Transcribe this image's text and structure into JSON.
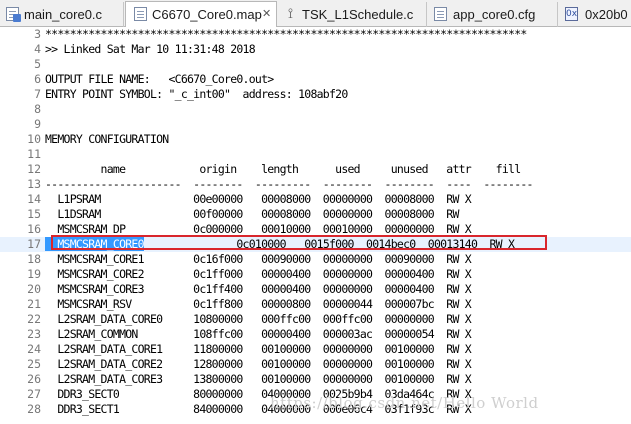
{
  "tabs": [
    {
      "label": "main_core0.c",
      "icon": "c-file-icon",
      "active": false,
      "close": ""
    },
    {
      "label": "C6670_Core0.map",
      "icon": "text-file-icon",
      "active": true,
      "close": "✕"
    },
    {
      "label": "TSK_L1Schedule.c",
      "icon": "tsk-file-icon",
      "active": false,
      "close": ""
    },
    {
      "label": "app_core0.cfg",
      "icon": "cfg-file-icon",
      "active": false,
      "close": ""
    },
    {
      "label": "0x20b0",
      "icon": "memory-icon",
      "active": false,
      "close": ""
    }
  ],
  "hex_icon_glyph": "0x",
  "tsk_icon_glyph": "⟟",
  "editor": {
    "lines": [
      {
        "n": "3",
        "text": "******************************************************************************"
      },
      {
        "n": "4",
        "text": ">> Linked Sat Mar 10 11:31:48 2018"
      },
      {
        "n": "5",
        "text": ""
      },
      {
        "n": "6",
        "text": "OUTPUT FILE NAME:   <C6670_Core0.out>"
      },
      {
        "n": "7",
        "text": "ENTRY POINT SYMBOL: \"_c_int00\"  address: 108abf20"
      },
      {
        "n": "8",
        "text": ""
      },
      {
        "n": "9",
        "text": ""
      },
      {
        "n": "10",
        "text": "MEMORY CONFIGURATION"
      },
      {
        "n": "11",
        "text": ""
      },
      {
        "n": "12",
        "text": "         name            origin    length      used     unused   attr    fill"
      },
      {
        "n": "13",
        "text": "----------------------  --------  ---------  --------  --------  ----  --------"
      },
      {
        "n": "14",
        "text": "  L1PSRAM               00e00000   00008000  00000000  00008000  RW X"
      },
      {
        "n": "15",
        "text": "  L1DSRAM               00f00000   00008000  00000000  00008000  RW"
      },
      {
        "n": "16",
        "text": "  MSMCSRAM_DP           0c000000   00010000  00010000  00000000  RW X"
      },
      {
        "n": "17",
        "text": "               0c010000   0015f000  0014bec0  00013140  RW X",
        "sel": "  MSMCSRAM_CORE0",
        "current": true
      },
      {
        "n": "18",
        "text": "  MSMCSRAM_CORE1        0c16f000   00090000  00000000  00090000  RW X"
      },
      {
        "n": "19",
        "text": "  MSMCSRAM_CORE2        0c1ff000   00000400  00000000  00000400  RW X"
      },
      {
        "n": "20",
        "text": "  MSMCSRAM_CORE3        0c1ff400   00000400  00000000  00000400  RW X"
      },
      {
        "n": "21",
        "text": "  MSMCSRAM_RSV          0c1ff800   00000800  00000044  000007bc  RW X"
      },
      {
        "n": "22",
        "text": "  L2SRAM_DATA_CORE0     10800000   000ffc00  000ffc00  00000000  RW X"
      },
      {
        "n": "23",
        "text": "  L2SRAM_COMMON         108ffc00   00000400  000003ac  00000054  RW X"
      },
      {
        "n": "24",
        "text": "  L2SRAM_DATA_CORE1     11800000   00100000  00000000  00100000  RW X"
      },
      {
        "n": "25",
        "text": "  L2SRAM_DATA_CORE2     12800000   00100000  00000000  00100000  RW X"
      },
      {
        "n": "26",
        "text": "  L2SRAM_DATA_CORE3     13800000   00100000  00000000  00100000  RW X"
      },
      {
        "n": "27",
        "text": "  DDR3_SECT0            80000000   04000000  0025b9b4  03da464c  RW X"
      },
      {
        "n": "28",
        "text": "  DDR3_SECT1            84000000   04000000  000e06c4  03f1f93c  RW X"
      }
    ]
  },
  "watermark": "https://blog.csdn.net/Hello World"
}
